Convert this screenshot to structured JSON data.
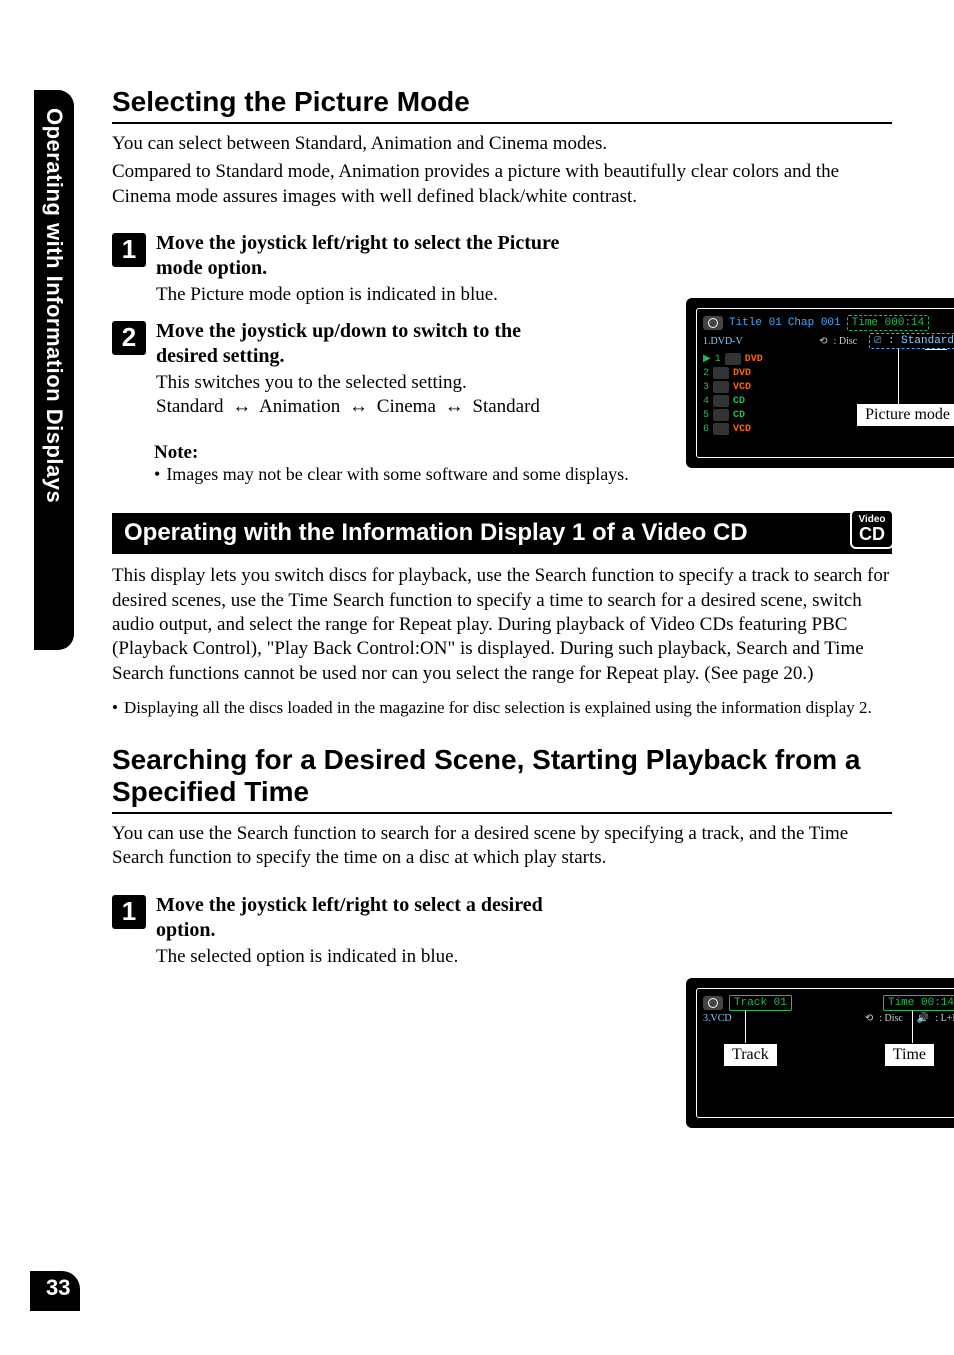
{
  "sideTab": "Operating with Information Displays",
  "h1": "Selecting the Picture Mode",
  "intro1": "You can select between Standard, Animation and Cinema modes.",
  "intro2": "Compared to Standard mode, Animation provides a picture with beautifully clear colors and the Cinema mode assures images with well defined black/white contrast.",
  "step1": {
    "num": "1",
    "title": "Move the joystick left/right to select the Picture mode option.",
    "text": "The Picture mode option is indicated in blue."
  },
  "step2": {
    "num": "2",
    "title": "Move the joystick up/down to switch to the desired setting.",
    "text": "This switches you to the selected setting.",
    "cycle": [
      "Standard",
      "Animation",
      "Cinema",
      "Standard"
    ]
  },
  "noteH": "Note:",
  "note1": "Images may not be clear with some software and some displays.",
  "blackBar": "Operating with the Information Display 1 of a Video CD",
  "badge": {
    "line1": "Video",
    "line2": "CD"
  },
  "para2": "This display lets you switch discs for playback, use the Search function to specify a track to search for desired scenes, use the Time Search function to specify a time to search for a desired scene, switch audio output, and select the range for Repeat play. During playback of Video CDs featuring PBC (Playback Control), \"Play Back Control:ON\" is displayed. During such playback, Search and Time Search functions cannot be used nor can you select the range for Repeat play. (See page 20.)",
  "subBullet": "Displaying all the discs loaded in the magazine for disc selection is explained using the information display 2.",
  "h2": "Searching for a Desired Scene, Starting Playback from a Specified Time",
  "para3": "You can use the Search function to search for a desired scene by specifying a track, and the Time Search function to specify the time on a disc at which play starts.",
  "stepB1": {
    "num": "1",
    "title": "Move the joystick left/right to select a desired option.",
    "text": "The selected option is indicated in blue."
  },
  "fig1": {
    "disc": "1.DVD-V",
    "title": "Title 01",
    "chap": "Chap 001",
    "time": "Time 000:14",
    "repeat": ": Disc",
    "mode": ": Standard",
    "list": [
      {
        "n": "1",
        "type": "DVD"
      },
      {
        "n": "2",
        "type": "DVD"
      },
      {
        "n": "3",
        "type": "VCD"
      },
      {
        "n": "4",
        "type": "CD"
      },
      {
        "n": "5",
        "type": "CD"
      },
      {
        "n": "6",
        "type": "VCD"
      }
    ],
    "callout": "Picture mode"
  },
  "fig2": {
    "disc": "3.VCD",
    "track": "Track 01",
    "time": "Time   00:14",
    "repeat": ": Disc",
    "audio": ": L+R",
    "calloutL": "Track",
    "calloutR": "Time"
  },
  "pageNum": "33"
}
